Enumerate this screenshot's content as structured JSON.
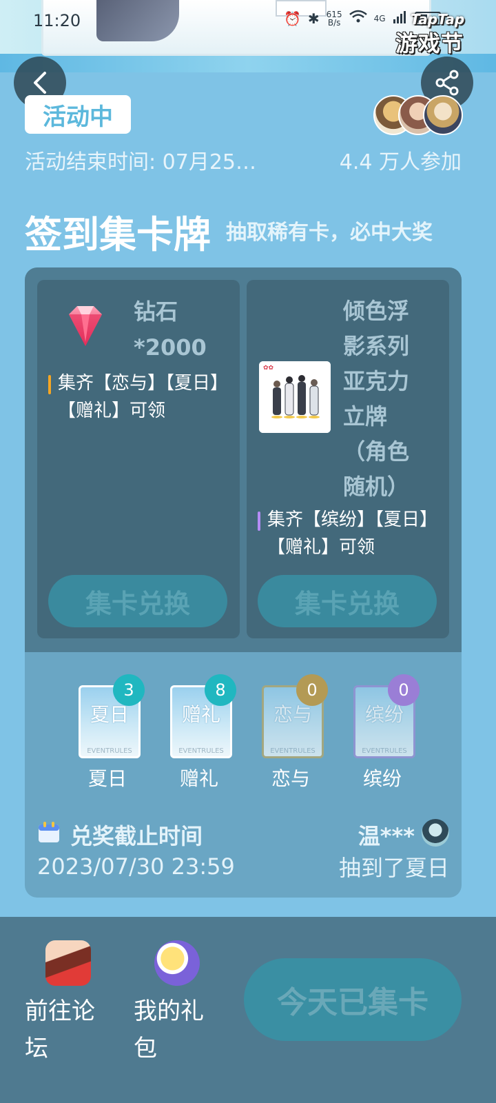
{
  "status_bar": {
    "time": "11:20",
    "speed_value": "615",
    "speed_unit": "B/s",
    "network": "4G"
  },
  "brand": {
    "taptap": "TapTap",
    "festival": "游戏节"
  },
  "event": {
    "status": "活动中",
    "end_time": "活动结束时间: 07月25…",
    "participants": "4.4 万人参加",
    "title": "签到集卡牌",
    "subtitle": "抽取稀有卡，必中大奖"
  },
  "rewards": [
    {
      "name_line1": "钻石",
      "name_line2": "*2000",
      "condition": "集齐【恋与】【夏日】【赠礼】可领",
      "condition_color": "#f5a623",
      "button": "集卡兑换"
    },
    {
      "name_lines": [
        "倾色浮",
        "影系列",
        "亚克力",
        "立牌",
        "（角色",
        "随机）"
      ],
      "condition": "集齐【缤纷】【夏日】【赠礼】可领",
      "condition_color": "#b58cf5",
      "button": "集卡兑换"
    }
  ],
  "cards": [
    {
      "face": "夏日",
      "label": "夏日",
      "count": "3",
      "badge_color": "#20b7c0"
    },
    {
      "face": "赠礼",
      "label": "赠礼",
      "count": "8",
      "badge_color": "#20b7c0"
    },
    {
      "face": "恋与",
      "label": "恋与",
      "count": "0",
      "badge_color": "#b39a55"
    },
    {
      "face": "缤纷",
      "label": "缤纷",
      "count": "0",
      "badge_color": "#9a7ed6"
    }
  ],
  "card_footer_text": "EVENTRULES",
  "deadline": {
    "title": "兑奖截止时间",
    "date": "2023/07/30 23:59"
  },
  "winner": {
    "name": "温***",
    "text": "抽到了夏日"
  },
  "bottom": {
    "forum": "前往论坛",
    "gifts": "我的礼包",
    "today": "今天已集卡"
  }
}
